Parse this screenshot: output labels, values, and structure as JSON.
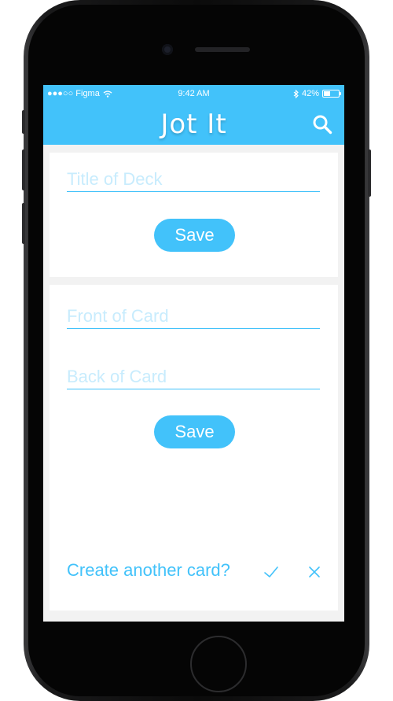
{
  "status_bar": {
    "carrier": "●●●○○ Figma",
    "time": "9:42 AM",
    "battery_percent": "42%",
    "battery_level": 0.42
  },
  "header": {
    "title": "Jot It",
    "search_icon": "search-icon"
  },
  "deck_panel": {
    "title_placeholder": "Title of Deck",
    "title_value": "",
    "save_label": "Save"
  },
  "card_panel": {
    "front_placeholder": "Front of Card",
    "front_value": "",
    "back_placeholder": "Back of Card",
    "back_value": "",
    "save_label": "Save",
    "prompt": "Create another card?",
    "confirm_icon": "check-icon",
    "dismiss_icon": "close-icon"
  },
  "colors": {
    "accent": "#42c2fa",
    "placeholder": "#c8ecfd",
    "background": "#f2f2f2",
    "panel": "#ffffff"
  }
}
